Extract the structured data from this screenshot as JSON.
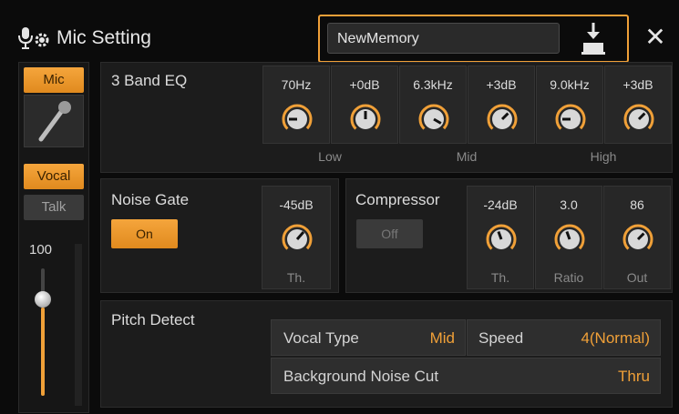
{
  "header": {
    "title": "Mic Setting",
    "memory_name": "NewMemory",
    "close_glyph": "✕",
    "accent_color": "#f0a038"
  },
  "left": {
    "tab_mic": "Mic",
    "tab_vocal": "Vocal",
    "tab_talk": "Talk",
    "volume": "100",
    "volume_level": 0.7
  },
  "eq": {
    "title": "3 Band EQ",
    "cells": [
      {
        "value": "70Hz"
      },
      {
        "value": "+0dB"
      },
      {
        "value": "6.3kHz"
      },
      {
        "value": "+3dB"
      },
      {
        "value": "9.0kHz"
      },
      {
        "value": "+3dB"
      }
    ],
    "bands": [
      "Low",
      "Mid",
      "High"
    ]
  },
  "noise_gate": {
    "title": "Noise Gate",
    "button": "On",
    "value": "-45dB",
    "label": "Th."
  },
  "compressor": {
    "title": "Compressor",
    "button": "Off",
    "cells": [
      {
        "value": "-24dB",
        "label": "Th."
      },
      {
        "value": "3.0",
        "label": "Ratio"
      },
      {
        "value": "86",
        "label": "Out"
      }
    ]
  },
  "pitch_detect": {
    "title": "Pitch Detect",
    "vocal_type_label": "Vocal Type",
    "vocal_type_value": "Mid",
    "speed_label": "Speed",
    "speed_value": "4(Normal)",
    "noise_cut_label": "Background Noise Cut",
    "noise_cut_value": "Thru"
  }
}
